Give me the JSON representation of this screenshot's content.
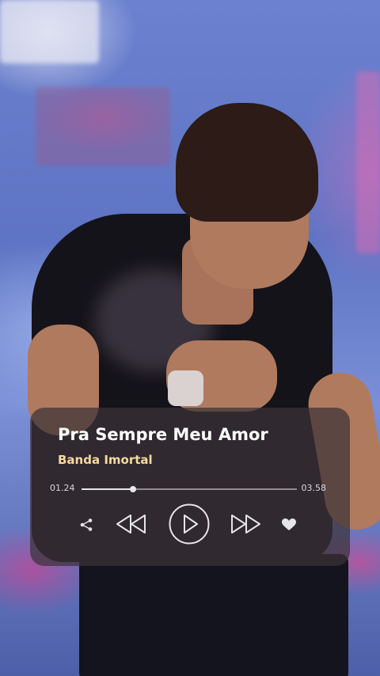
{
  "player": {
    "title": "Pra Sempre Meu Amor",
    "artist": "Banda Imortal",
    "current_time": "01.24",
    "total_time": "03.58",
    "progress": 0.24,
    "controls": {
      "share_icon": "share-icon",
      "previous_icon": "rewind-icon",
      "play_icon": "play-icon",
      "next_icon": "fast-forward-icon",
      "like_icon": "heart-icon"
    }
  },
  "colors": {
    "title": "#ffffff",
    "artist": "#f6d9a0",
    "card_background": "#3c3237",
    "icon": "#e6e6ea"
  }
}
